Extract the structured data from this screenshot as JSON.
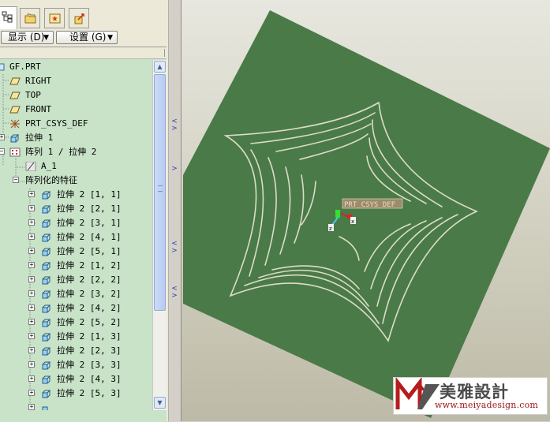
{
  "panel": {
    "display_label": "显示 (D)",
    "settings_label": "设置 (G)"
  },
  "tree": {
    "items": [
      {
        "label": "GF.PRT",
        "icon": "part-icon"
      },
      {
        "label": "RIGHT",
        "icon": "datum-plane-icon"
      },
      {
        "label": "TOP",
        "icon": "datum-plane-icon"
      },
      {
        "label": "FRONT",
        "icon": "datum-plane-icon"
      },
      {
        "label": "PRT_CSYS_DEF",
        "icon": "csys-icon"
      },
      {
        "label": "拉伸 1",
        "icon": "extrude-icon"
      },
      {
        "label": "阵列 1 / 拉伸 2",
        "icon": "pattern-icon"
      },
      {
        "label": "A_1",
        "icon": "axis-icon"
      },
      {
        "label": "阵列化的特征",
        "icon": ""
      },
      {
        "label": "拉伸 2 [1, 1]",
        "icon": "extrude-icon"
      },
      {
        "label": "拉伸 2 [2, 1]",
        "icon": "extrude-icon"
      },
      {
        "label": "拉伸 2 [3, 1]",
        "icon": "extrude-icon"
      },
      {
        "label": "拉伸 2 [4, 1]",
        "icon": "extrude-icon"
      },
      {
        "label": "拉伸 2 [5, 1]",
        "icon": "extrude-icon"
      },
      {
        "label": "拉伸 2 [1, 2]",
        "icon": "extrude-icon"
      },
      {
        "label": "拉伸 2 [2, 2]",
        "icon": "extrude-icon"
      },
      {
        "label": "拉伸 2 [3, 2]",
        "icon": "extrude-icon"
      },
      {
        "label": "拉伸 2 [4, 2]",
        "icon": "extrude-icon"
      },
      {
        "label": "拉伸 2 [5, 2]",
        "icon": "extrude-icon"
      },
      {
        "label": "拉伸 2 [1, 3]",
        "icon": "extrude-icon"
      },
      {
        "label": "拉伸 2 [2, 3]",
        "icon": "extrude-icon"
      },
      {
        "label": "拉伸 2 [3, 3]",
        "icon": "extrude-icon"
      },
      {
        "label": "拉伸 2 [4, 3]",
        "icon": "extrude-icon"
      },
      {
        "label": "拉伸 2 [5, 3]",
        "icon": "extrude-icon"
      }
    ]
  },
  "viewport": {
    "csys_label": "PRT_CSYS_DEF",
    "axis_x": "x",
    "axis_z": "z",
    "plate_color": "#4a7a48",
    "curve_color": "#dcdcc8"
  },
  "watermark": {
    "brand": "美雅設計",
    "url": "www.meiyadesign.com"
  }
}
